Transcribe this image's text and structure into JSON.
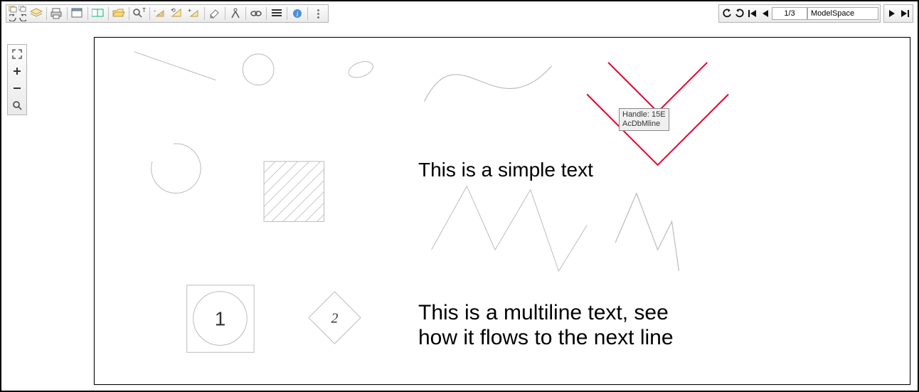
{
  "nav": {
    "page_indicator": "1/3",
    "layout_name": "ModelSpace"
  },
  "tooltip": {
    "line1": "Handle: 15E",
    "line2": "AcDbMline"
  },
  "canvas": {
    "simple_text": "This is a simple text",
    "multiline_text_l1": "This is a multiline text, see",
    "multiline_text_l2": "how it flows to the next line",
    "num1": "1",
    "num2": "2"
  },
  "icons": {
    "copy": "copy",
    "cascade": "cascade",
    "layers": "layers",
    "back": "back",
    "fwd": "forward",
    "print": "print",
    "window": "window",
    "compare": "compare",
    "open": "open",
    "search_text": "search-text",
    "zoom_out_small": "zoom-out",
    "zoom_fit": "zoom-fit",
    "zoom_in_small": "zoom-in",
    "eraser": "eraser",
    "compass": "compass",
    "link": "link",
    "list": "list",
    "info": "info",
    "more": "more",
    "undo": "undo",
    "redo": "redo",
    "first": "first",
    "prev": "prev",
    "next": "next",
    "last": "last",
    "expand": "expand",
    "plus": "plus",
    "minus": "minus",
    "magnify": "magnify"
  }
}
